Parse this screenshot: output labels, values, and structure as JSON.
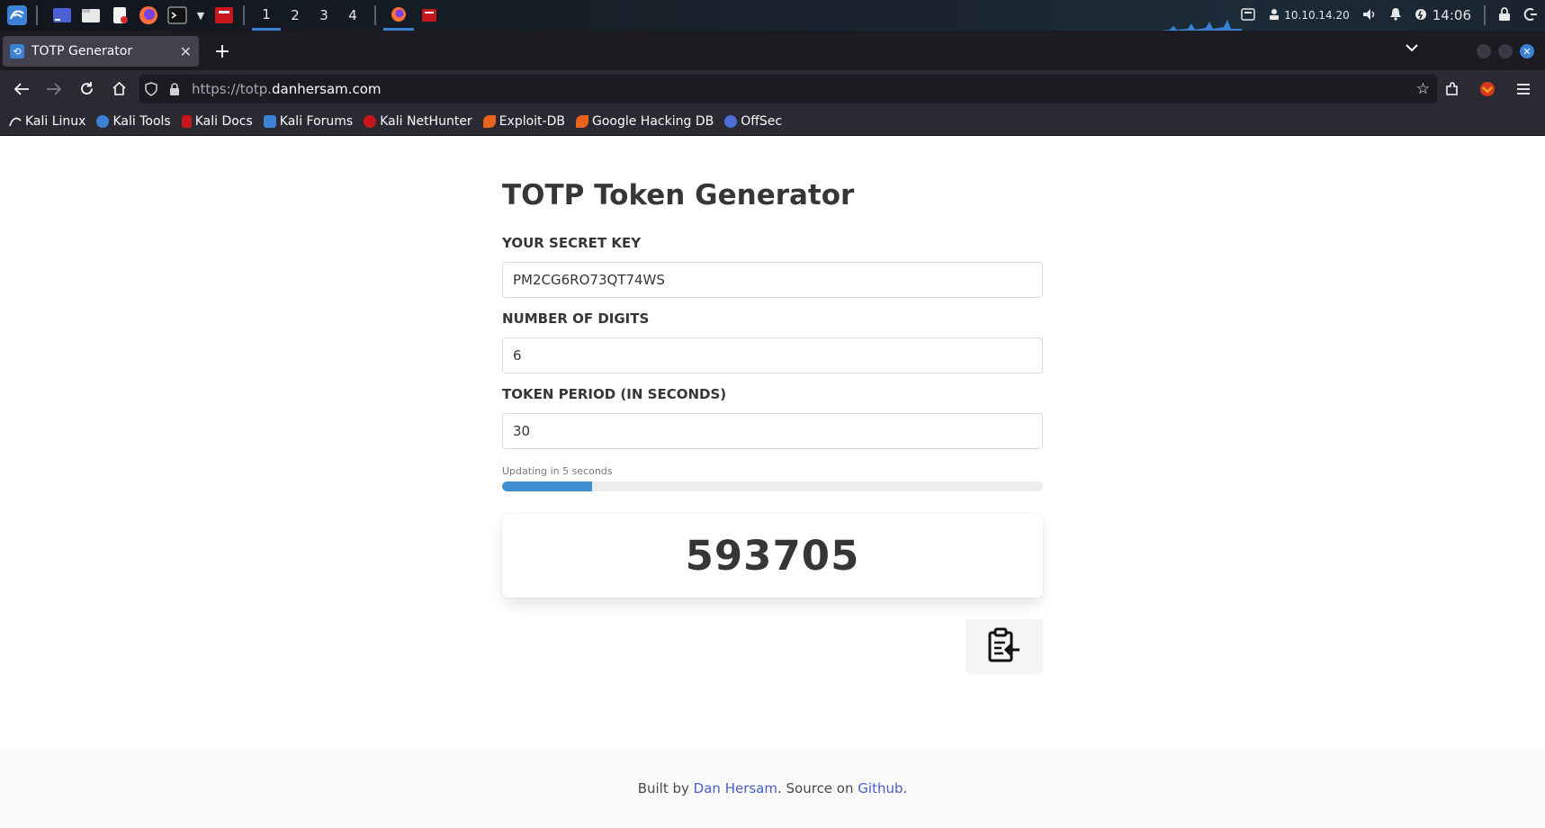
{
  "taskbar": {
    "workspaces": [
      "1",
      "2",
      "3",
      "4"
    ],
    "tray": {
      "ip": "10.10.14.20",
      "clock": "14:06"
    }
  },
  "browser": {
    "tab_title": "TOTP Generator",
    "url_prefix": "https://totp.",
    "url_host": "danhersam.com",
    "bookmarks": [
      "Kali Linux",
      "Kali Tools",
      "Kali Docs",
      "Kali Forums",
      "Kali NetHunter",
      "Exploit-DB",
      "Google Hacking DB",
      "OffSec"
    ]
  },
  "page": {
    "title": "TOTP Token Generator",
    "secret_label": "YOUR SECRET KEY",
    "secret_value": "PM2CG6RO73QT74WS",
    "digits_label": "NUMBER OF DIGITS",
    "digits_value": "6",
    "period_label": "TOKEN PERIOD (IN SECONDS)",
    "period_value": "30",
    "progress_text": "Updating in 5 seconds",
    "progress_fraction": 0.1667,
    "token": "593705"
  },
  "footer": {
    "prefix": "Built by ",
    "author": "Dan Hersam",
    "middle": ". Source on ",
    "source": "Github",
    "suffix": "."
  },
  "colors": {
    "accent": "#3e8ed0",
    "link": "#485fc7",
    "kali_blue": "#3b82d6"
  }
}
